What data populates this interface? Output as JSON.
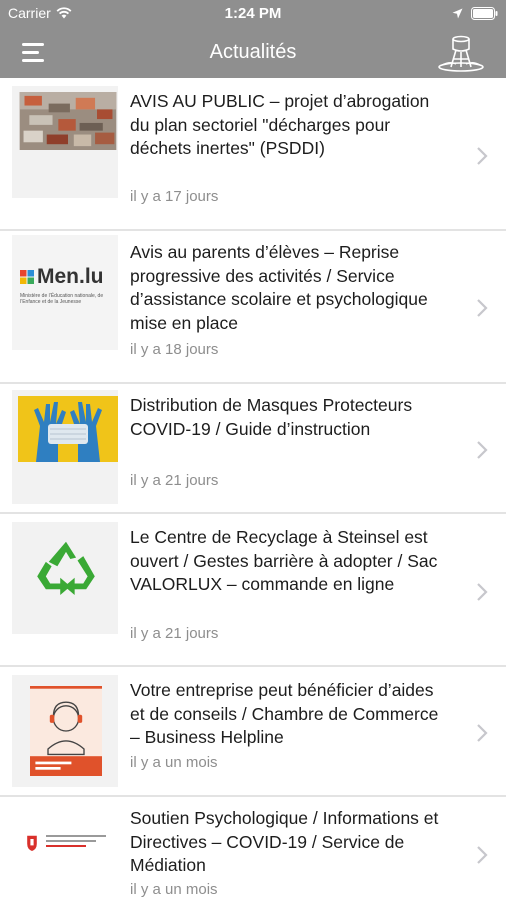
{
  "status_bar": {
    "carrier": "Carrier",
    "time": "1:24 PM"
  },
  "nav": {
    "title": "Actualités"
  },
  "articles": [
    {
      "title": "AVIS AU PUBLIC – projet d’abrogation du plan sectoriel \"décharges pour déchets inertes\" (PSDDI)",
      "date": "il y a 17 jours"
    },
    {
      "title": "Avis au parents d’élèves – Reprise progressive des activités / Service d’assistance scolaire et psychologique mise en place",
      "date": "il y a 18 jours"
    },
    {
      "title": "Distribution de Masques Protecteurs COVID-19 / Guide d’instruction",
      "date": "il y a 21 jours"
    },
    {
      "title": "Le Centre de Recyclage à Steinsel est ouvert / Gestes barrière à adopter / Sac VALORLUX – commande en ligne",
      "date": "il y a 21 jours"
    },
    {
      "title": "Votre entreprise peut bénéficier d’aides et de conseils / Chambre de Commerce – Business Helpline",
      "date": "il y a un mois"
    },
    {
      "title": "Soutien Psychologique / Informations et Directives – COVID-19 / Service de Médiation",
      "date": "il y a un mois"
    }
  ],
  "thumbnails": {
    "men_logo_text": "Men.lu",
    "men_logo_subtitle": "Ministère de l’Éducation nationale, de l’Enfance et de la Jeunesse"
  },
  "colors": {
    "bar": "#8f8f8f",
    "divider": "#e3e3e3",
    "date": "#8e8e8e",
    "chevron": "#c7c7cc"
  }
}
